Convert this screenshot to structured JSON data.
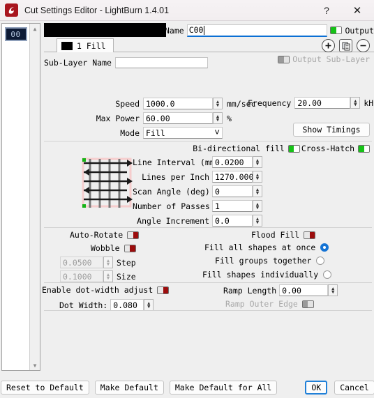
{
  "window": {
    "title": "Cut Settings Editor - LightBurn 1.4.01",
    "help_icon": "?",
    "close_icon": "✕",
    "logo_icon": "lightburn-logo-icon"
  },
  "layer_list": {
    "items": [
      {
        "label": "00",
        "color": "#0d1b36"
      }
    ],
    "scroll_up_icon": "▲",
    "scroll_down_icon": "▼"
  },
  "header": {
    "layer_color": "#000000",
    "tab_label": "1 Fill",
    "name_label": "Name",
    "name_value": "C00",
    "output_label": "Output",
    "output_on": true,
    "add_icon": "plus-circle-icon",
    "duplicate_icon": "copy-icon",
    "remove_icon": "minus-circle-icon",
    "output_sublayer_label": "Output Sub-Layer",
    "output_sublayer_enabled": false,
    "sublayer_name_label": "Sub-Layer Name",
    "sublayer_name_value": ""
  },
  "cut": {
    "speed_label": "Speed",
    "speed_value": "1000.0",
    "speed_units": "mm/sec",
    "max_power_label": "Max Power",
    "max_power_value": "60.00",
    "max_power_units": "%",
    "mode_label": "Mode",
    "mode_value": "Fill",
    "mode_caret": "⌄",
    "frequency_label": "Frequency",
    "frequency_value": "20.00",
    "frequency_units": "kHz",
    "show_timings_label": "Show Timings"
  },
  "fill": {
    "bidirectional_label": "Bi-directional fill",
    "bidirectional_on": true,
    "crosshatch_label": "Cross-Hatch",
    "crosshatch_on": true,
    "line_interval_label": "Line Interval (mm)",
    "line_interval_value": "0.0200",
    "lines_per_inch_label": "Lines per Inch",
    "lines_per_inch_value": "1270.000",
    "scan_angle_label": "Scan Angle (deg)",
    "scan_angle_value": "0",
    "num_passes_label": "Number of Passes",
    "num_passes_value": "1",
    "angle_increment_label": "Angle Increment",
    "angle_increment_value": "0.0"
  },
  "options": {
    "auto_rotate_label": "Auto-Rotate",
    "auto_rotate_on": false,
    "flood_fill_label": "Flood Fill",
    "flood_fill_on": false,
    "wobble_label": "Wobble",
    "wobble_on": false,
    "step_label": "Step",
    "step_value": "0.0500",
    "size_label": "Size",
    "size_value": "0.1000",
    "fill_all_label": "Fill all shapes at once",
    "fill_groups_label": "Fill groups together",
    "fill_individually_label": "Fill shapes individually",
    "fill_mode_selected": "all"
  },
  "dot": {
    "enable_label": "Enable dot-width adjust",
    "enable_on": false,
    "dot_width_label": "Dot Width:",
    "dot_width_value": "0.080",
    "ramp_length_label": "Ramp Length",
    "ramp_length_value": "0.00",
    "ramp_outer_label": "Ramp Outer Edge",
    "ramp_outer_enabled": false
  },
  "footer": {
    "reset_label": "Reset to Default",
    "make_default_label": "Make Default",
    "make_default_all_label": "Make Default for All",
    "ok_label": "OK",
    "cancel_label": "Cancel"
  },
  "colors": {
    "accent": "#0b6fd4",
    "toggle_on": "#16c217",
    "toggle_off": "#9c0d0d",
    "background": "#efefef"
  }
}
